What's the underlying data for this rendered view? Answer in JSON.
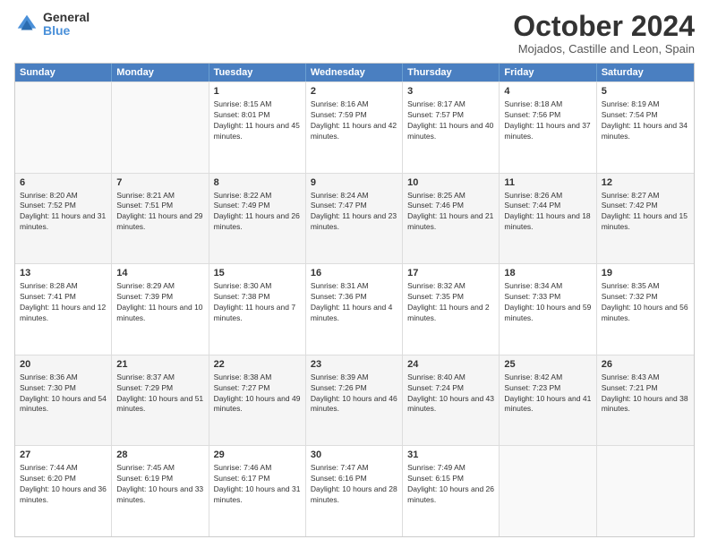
{
  "logo": {
    "general": "General",
    "blue": "Blue"
  },
  "title": "October 2024",
  "subtitle": "Mojados, Castille and Leon, Spain",
  "header_days": [
    "Sunday",
    "Monday",
    "Tuesday",
    "Wednesday",
    "Thursday",
    "Friday",
    "Saturday"
  ],
  "rows": [
    [
      {
        "day": "",
        "info": ""
      },
      {
        "day": "",
        "info": ""
      },
      {
        "day": "1",
        "info": "Sunrise: 8:15 AM\nSunset: 8:01 PM\nDaylight: 11 hours and 45 minutes."
      },
      {
        "day": "2",
        "info": "Sunrise: 8:16 AM\nSunset: 7:59 PM\nDaylight: 11 hours and 42 minutes."
      },
      {
        "day": "3",
        "info": "Sunrise: 8:17 AM\nSunset: 7:57 PM\nDaylight: 11 hours and 40 minutes."
      },
      {
        "day": "4",
        "info": "Sunrise: 8:18 AM\nSunset: 7:56 PM\nDaylight: 11 hours and 37 minutes."
      },
      {
        "day": "5",
        "info": "Sunrise: 8:19 AM\nSunset: 7:54 PM\nDaylight: 11 hours and 34 minutes."
      }
    ],
    [
      {
        "day": "6",
        "info": "Sunrise: 8:20 AM\nSunset: 7:52 PM\nDaylight: 11 hours and 31 minutes."
      },
      {
        "day": "7",
        "info": "Sunrise: 8:21 AM\nSunset: 7:51 PM\nDaylight: 11 hours and 29 minutes."
      },
      {
        "day": "8",
        "info": "Sunrise: 8:22 AM\nSunset: 7:49 PM\nDaylight: 11 hours and 26 minutes."
      },
      {
        "day": "9",
        "info": "Sunrise: 8:24 AM\nSunset: 7:47 PM\nDaylight: 11 hours and 23 minutes."
      },
      {
        "day": "10",
        "info": "Sunrise: 8:25 AM\nSunset: 7:46 PM\nDaylight: 11 hours and 21 minutes."
      },
      {
        "day": "11",
        "info": "Sunrise: 8:26 AM\nSunset: 7:44 PM\nDaylight: 11 hours and 18 minutes."
      },
      {
        "day": "12",
        "info": "Sunrise: 8:27 AM\nSunset: 7:42 PM\nDaylight: 11 hours and 15 minutes."
      }
    ],
    [
      {
        "day": "13",
        "info": "Sunrise: 8:28 AM\nSunset: 7:41 PM\nDaylight: 11 hours and 12 minutes."
      },
      {
        "day": "14",
        "info": "Sunrise: 8:29 AM\nSunset: 7:39 PM\nDaylight: 11 hours and 10 minutes."
      },
      {
        "day": "15",
        "info": "Sunrise: 8:30 AM\nSunset: 7:38 PM\nDaylight: 11 hours and 7 minutes."
      },
      {
        "day": "16",
        "info": "Sunrise: 8:31 AM\nSunset: 7:36 PM\nDaylight: 11 hours and 4 minutes."
      },
      {
        "day": "17",
        "info": "Sunrise: 8:32 AM\nSunset: 7:35 PM\nDaylight: 11 hours and 2 minutes."
      },
      {
        "day": "18",
        "info": "Sunrise: 8:34 AM\nSunset: 7:33 PM\nDaylight: 10 hours and 59 minutes."
      },
      {
        "day": "19",
        "info": "Sunrise: 8:35 AM\nSunset: 7:32 PM\nDaylight: 10 hours and 56 minutes."
      }
    ],
    [
      {
        "day": "20",
        "info": "Sunrise: 8:36 AM\nSunset: 7:30 PM\nDaylight: 10 hours and 54 minutes."
      },
      {
        "day": "21",
        "info": "Sunrise: 8:37 AM\nSunset: 7:29 PM\nDaylight: 10 hours and 51 minutes."
      },
      {
        "day": "22",
        "info": "Sunrise: 8:38 AM\nSunset: 7:27 PM\nDaylight: 10 hours and 49 minutes."
      },
      {
        "day": "23",
        "info": "Sunrise: 8:39 AM\nSunset: 7:26 PM\nDaylight: 10 hours and 46 minutes."
      },
      {
        "day": "24",
        "info": "Sunrise: 8:40 AM\nSunset: 7:24 PM\nDaylight: 10 hours and 43 minutes."
      },
      {
        "day": "25",
        "info": "Sunrise: 8:42 AM\nSunset: 7:23 PM\nDaylight: 10 hours and 41 minutes."
      },
      {
        "day": "26",
        "info": "Sunrise: 8:43 AM\nSunset: 7:21 PM\nDaylight: 10 hours and 38 minutes."
      }
    ],
    [
      {
        "day": "27",
        "info": "Sunrise: 7:44 AM\nSunset: 6:20 PM\nDaylight: 10 hours and 36 minutes."
      },
      {
        "day": "28",
        "info": "Sunrise: 7:45 AM\nSunset: 6:19 PM\nDaylight: 10 hours and 33 minutes."
      },
      {
        "day": "29",
        "info": "Sunrise: 7:46 AM\nSunset: 6:17 PM\nDaylight: 10 hours and 31 minutes."
      },
      {
        "day": "30",
        "info": "Sunrise: 7:47 AM\nSunset: 6:16 PM\nDaylight: 10 hours and 28 minutes."
      },
      {
        "day": "31",
        "info": "Sunrise: 7:49 AM\nSunset: 6:15 PM\nDaylight: 10 hours and 26 minutes."
      },
      {
        "day": "",
        "info": ""
      },
      {
        "day": "",
        "info": ""
      }
    ]
  ]
}
